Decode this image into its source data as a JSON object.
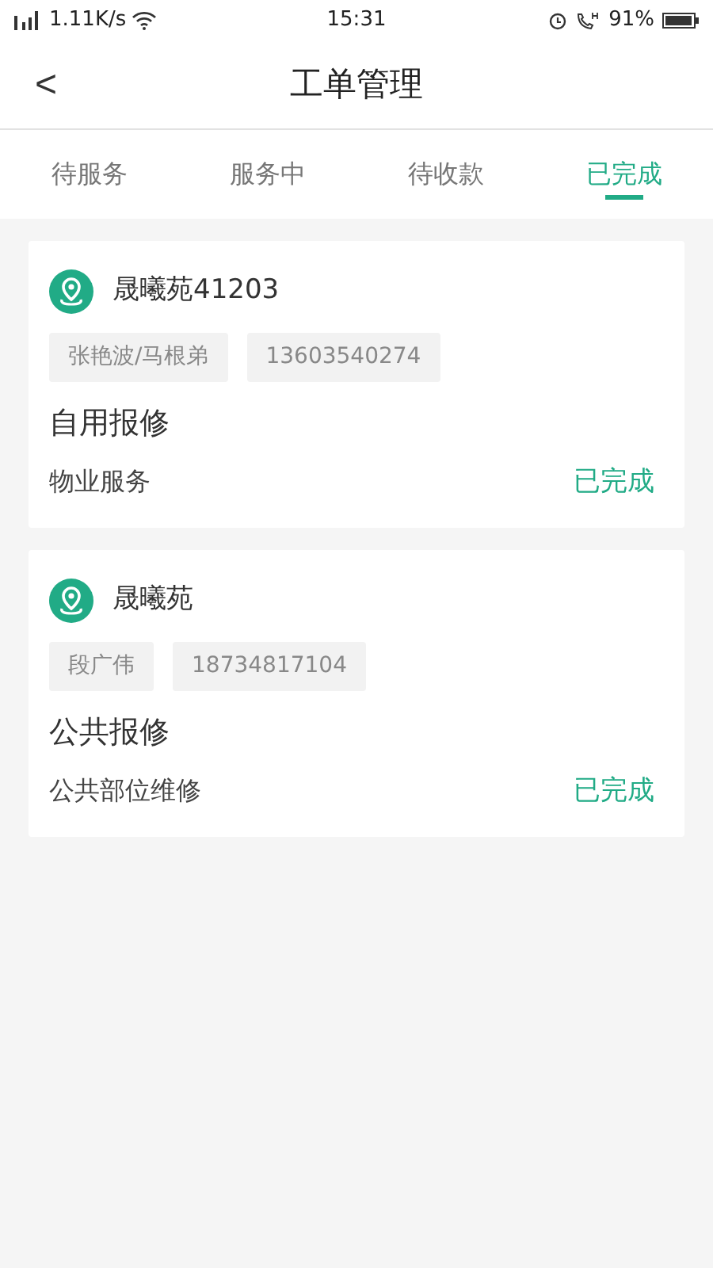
{
  "status_bar": {
    "speed": "1.11K/s",
    "time": "15:31",
    "battery": "91%"
  },
  "header": {
    "back": "<",
    "title": "工单管理"
  },
  "tabs": [
    {
      "label": "待服务",
      "selected": false
    },
    {
      "label": "服务中",
      "selected": false
    },
    {
      "label": "待收款",
      "selected": false
    },
    {
      "label": "已完成",
      "selected": true
    }
  ],
  "orders": [
    {
      "place": "晟曦苑41203",
      "contact": "张艳波/马根弟",
      "phone": "13603540274",
      "type": "自用报修",
      "category": "物业服务",
      "status": "已完成"
    },
    {
      "place": "晟曦苑",
      "contact": "段广伟",
      "phone": "18734817104",
      "type": "公共报修",
      "category": "公共部位维修",
      "status": "已完成"
    }
  ]
}
